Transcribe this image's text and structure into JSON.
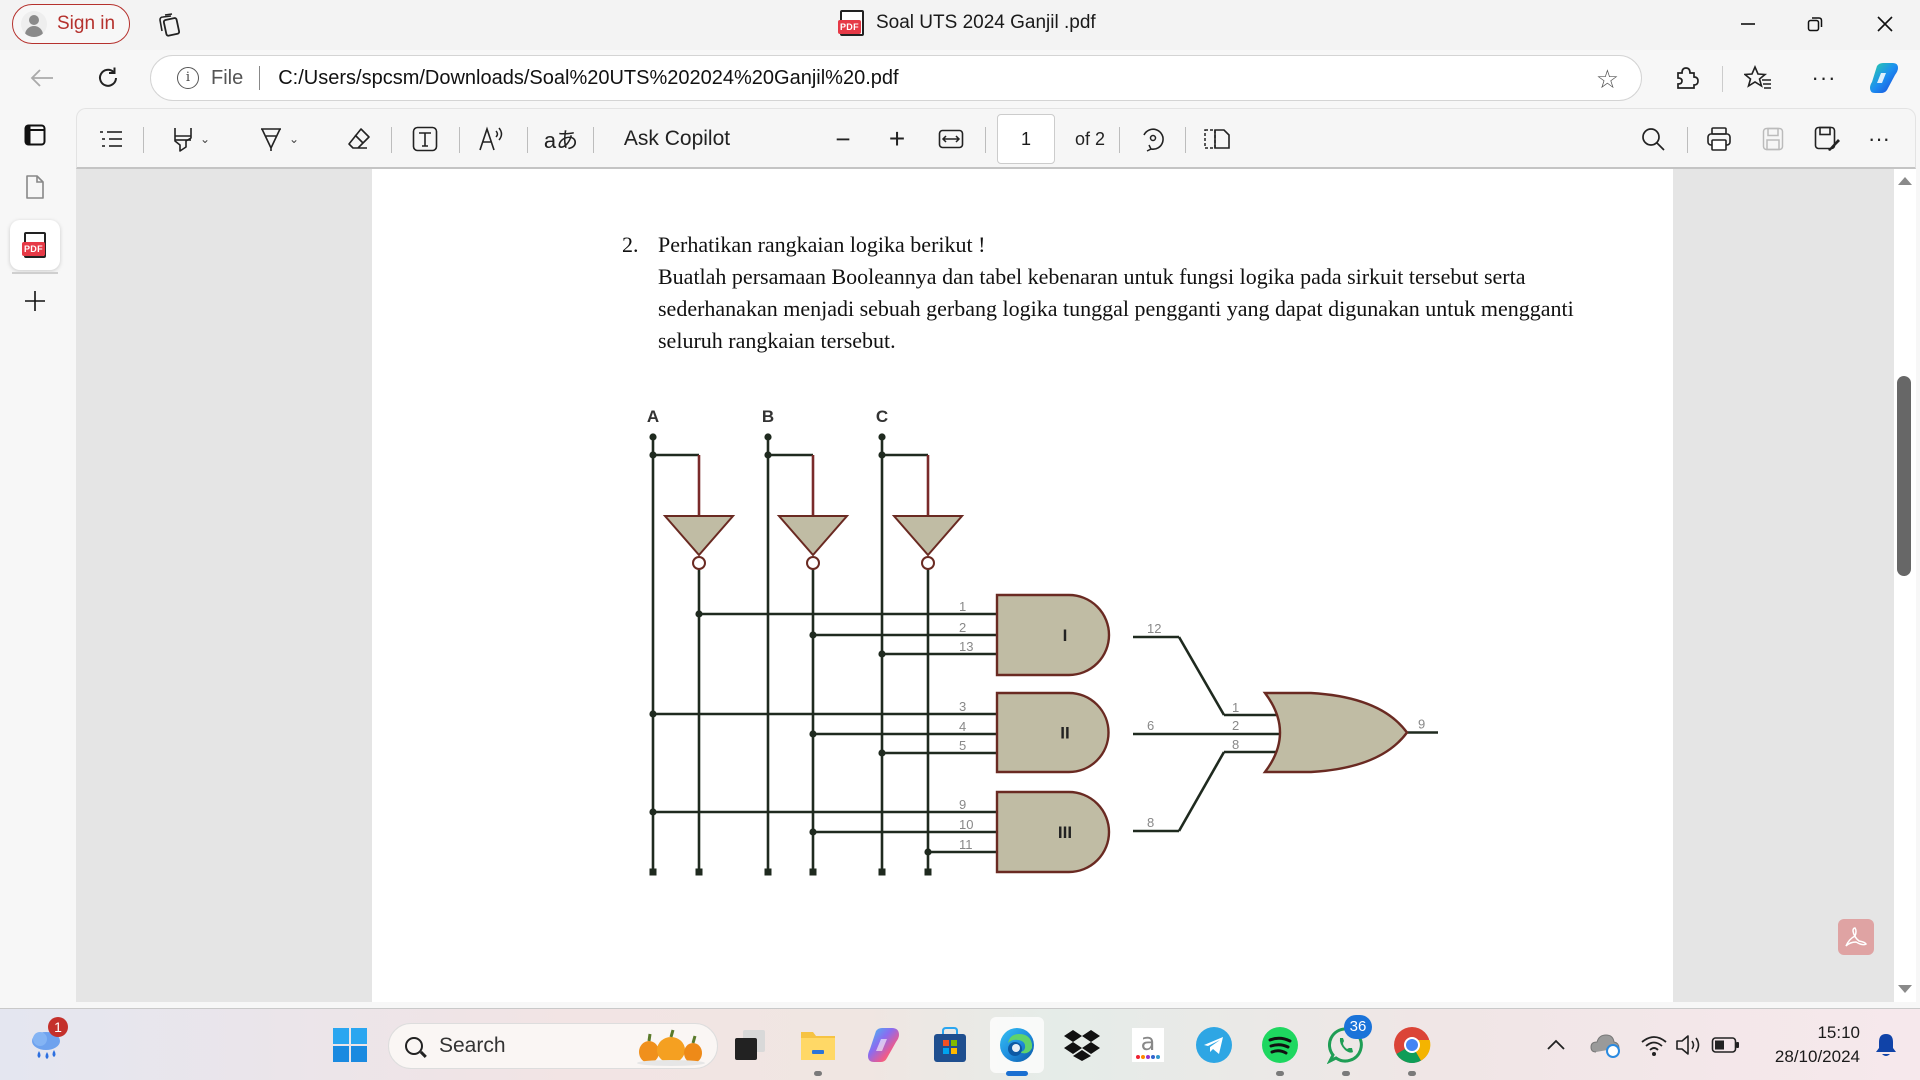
{
  "window": {
    "title": "Soal UTS 2024 Ganjil .pdf",
    "sign_in_label": "Sign in",
    "controls": [
      "minimize",
      "restore",
      "close"
    ]
  },
  "addressbar": {
    "scheme_label": "File",
    "url": "C:/Users/spcsm/Downloads/Soal%20UTS%202024%20Ganjil%20.pdf"
  },
  "pdf_toolbar": {
    "ask_copilot_label": "Ask Copilot",
    "zoom_out": "−",
    "zoom_in": "+",
    "current_page": "1",
    "page_count_label": "of 2"
  },
  "document": {
    "question_number": "2.",
    "question_title": "Perhatikan rangkaian logika berikut !",
    "question_body": "Buatlah persamaan Booleannya dan tabel kebenaran untuk fungsi logika pada sirkuit tersebut serta sederhanakan menjadi sebuah gerbang logika tunggal pengganti yang dapat digunakan untuk mengganti seluruh rangkaian tersebut.",
    "circuit": {
      "inputs": [
        "A",
        "B",
        "C"
      ],
      "and_gates": [
        {
          "label": "I",
          "pins": [
            "1",
            "2",
            "13"
          ],
          "out_pin": "12",
          "inputs": [
            "A'",
            "B'",
            "C"
          ]
        },
        {
          "label": "II",
          "pins": [
            "3",
            "4",
            "5"
          ],
          "out_pin": "6",
          "inputs": [
            "A",
            "B'",
            "C"
          ]
        },
        {
          "label": "III",
          "pins": [
            "9",
            "10",
            "11"
          ],
          "out_pin": "8",
          "inputs": [
            "A",
            "B'",
            "C'"
          ]
        }
      ],
      "or_gate": {
        "pins": [
          "1",
          "2",
          "8"
        ],
        "out_pin": "9"
      },
      "gate_fill": "#c0bca4",
      "gate_stroke": "#6a2a22"
    }
  },
  "taskbar": {
    "search_label": "Search",
    "weather_badge": "1",
    "whatsapp_badge": "36",
    "time": "15:10",
    "date": "28/10/2024",
    "apps": [
      "task-view",
      "file-explorer",
      "copilot",
      "microsoft-store",
      "edge",
      "dropbox",
      "amazon",
      "telegram",
      "spotify",
      "whatsapp",
      "chrome"
    ]
  },
  "colors": {
    "accent_signin": "#b5312d",
    "pdf_red": "#e63946",
    "taskbar_active": "#1a6fd1"
  }
}
